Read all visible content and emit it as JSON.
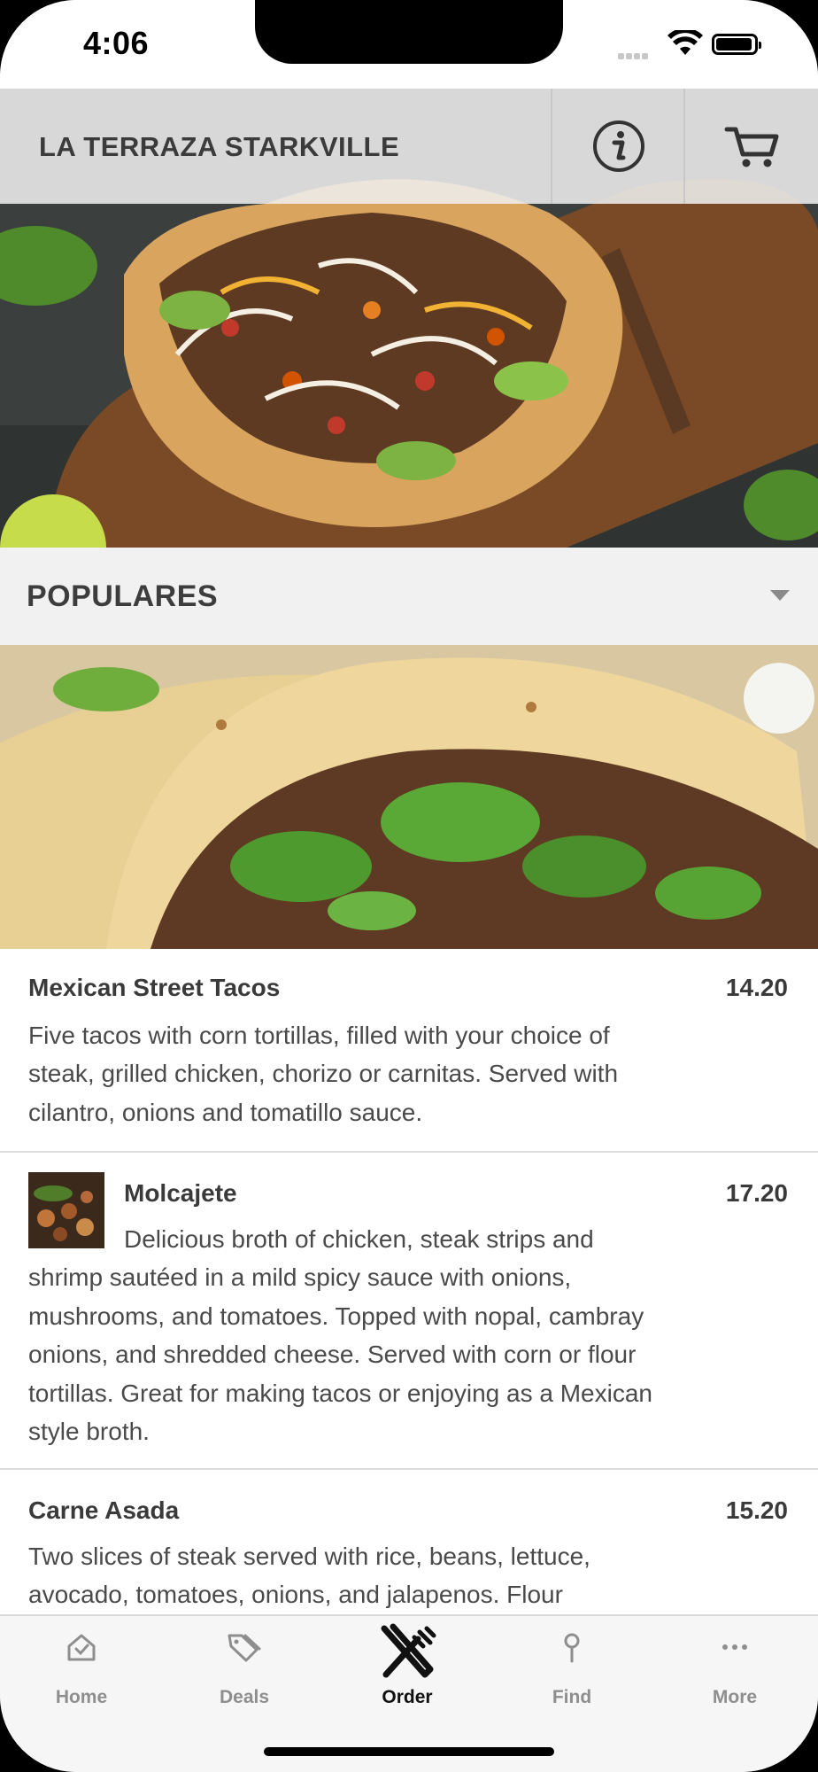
{
  "status_bar": {
    "time": "4:06"
  },
  "header": {
    "restaurant_name": "LA TERRAZA STARKVILLE",
    "info_icon": "info-icon",
    "cart_icon": "cart-icon"
  },
  "category": {
    "title": "POPULARES",
    "icon": "chevron-down-icon"
  },
  "menu_items": [
    {
      "name": "Mexican Street Tacos",
      "price": "14.20",
      "desc_lines": [
        "Five tacos with corn tortillas, filled with your choice of",
        "steak, grilled chicken, chorizo or carnitas. Served with",
        "cilantro, onions and tomatillo sauce."
      ]
    },
    {
      "name": "Molcajete",
      "price": "17.20",
      "desc_lines": [
        "Delicious broth of chicken, steak strips and",
        "shrimp sautéed in a mild spicy sauce with onions,",
        "mushrooms, and tomatoes. Topped with nopal, cambray",
        "onions, and shredded cheese. Served with corn or flour",
        "tortillas. Great for making tacos or enjoying as a Mexican",
        "style broth."
      ]
    },
    {
      "name": "Carne Asada",
      "price": "15.20",
      "desc_lines": [
        "Two slices of steak served with rice, beans, lettuce,",
        "avocado, tomatoes, onions, and jalapenos. Flour"
      ]
    }
  ],
  "tab_bar": {
    "tabs": [
      {
        "label": "Home",
        "icon": "home-icon",
        "active": false
      },
      {
        "label": "Deals",
        "icon": "tag-icon",
        "active": false
      },
      {
        "label": "Order",
        "icon": "fork-knife-icon",
        "active": true
      },
      {
        "label": "Find",
        "icon": "map-pin-icon",
        "active": false
      },
      {
        "label": "More",
        "icon": "more-dots-icon",
        "active": false
      }
    ]
  },
  "colors": {
    "accent": "#111111",
    "inactive": "#8e8e8e",
    "header_bg": "#eeeeee",
    "category_bg": "#f1f1f1"
  }
}
